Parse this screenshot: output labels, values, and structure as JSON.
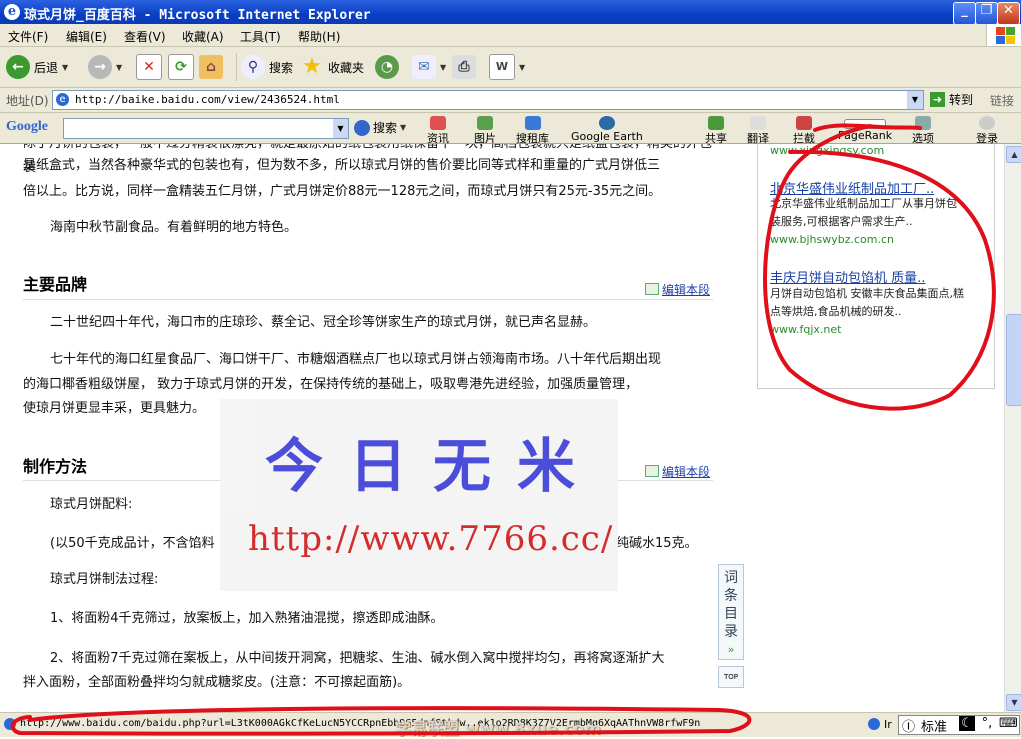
{
  "window": {
    "title": "琼式月饼_百度百科 - Microsoft Internet Explorer"
  },
  "menu": [
    "文件(F)",
    "编辑(E)",
    "查看(V)",
    "收藏(A)",
    "工具(T)",
    "帮助(H)"
  ],
  "toolbar": {
    "back": "后退",
    "search": "搜索",
    "favorites": "收藏夹"
  },
  "address": {
    "label": "地址(D)",
    "url": "http://baike.baidu.com/view/2436524.html",
    "go": "转到",
    "links": "链接"
  },
  "google": {
    "logo": "Google",
    "search": "搜索",
    "items": [
      "资讯",
      "图片",
      "搜租库",
      "Google Earth",
      "共享",
      "翻译",
      "拦截",
      "PageRank",
      "选项",
      "登录"
    ]
  },
  "article": {
    "para0a": "除了月饼的包装，一般不过分精装很漂亮，就是最原始的纸包装用纸保留下一块，高档包装就只是纸盒包装，精美的外包装",
    "para0b": "是纸盒式，当然各种豪华式的包装也有，但为数不多，所以琼式月饼的售价要比同等式样和重量的广式月饼低三",
    "para0c": "倍以上。比方说，同样一盒精装五仁月饼，广式月饼定价88元一128元之间，而琼式月饼只有25元-35元之间。",
    "para1": "海南中秋节副食品。有着鲜明的地方特色。",
    "heading1": "主要品牌",
    "edit": "编辑本段",
    "para2": "二十世纪四十年代，海口市的庄琼珍、蔡全记、冠全珍等饼家生产的琼式月饼，就已声名显赫。",
    "para3a": "七十年代的海口红星食品厂、海口饼干厂、市糖烟酒糕点厂也以琼式月饼占领海南市场。八十年代后期出现",
    "para3b": "的海口椰香粗级饼屋， 致力于琼式月饼的开发，在保持传统的基础上，吸取粤港先进经验，加强质量管理，",
    "para3c": "使琼月饼更显丰采，更具魅力。",
    "heading2": "制作方法",
    "para4": "琼式月饼配料:",
    "para5a": "(以50千克成品计，不含馅料",
    "para5b": "纯碱水15克。",
    "para6": "琼式月饼制法过程:",
    "para7": "1、将面粉4千克筛过，放案板上，加入熟猪油混搅，擦透即成油酥。",
    "para8a": "2、将面粉7千克过筛在案板上，从中间拨开洞窝，把糖浆、生油、碱水倒入窝中搅拌均匀，再将窝逐渐扩大",
    "para8b": "拌入面粉，全部面粉叠拌均匀就成糖浆皮。(注意：不可擦起面筋)。"
  },
  "ads": [
    {
      "url": "www.xingxingsy.com"
    },
    {
      "title": "北京华盛伟业纸制品加工厂..",
      "desc1": "北京华盛伟业纸制品加工厂从事月饼包",
      "desc2": "装服务,可根据客户需求生产..",
      "url": "www.bjhswybz.com.cn"
    },
    {
      "title": "丰庆月饼自动包馅机 质量..",
      "desc1": "月饼自动包馅机 安徽丰庆食品集面点,糕",
      "desc2": "点等烘焙,食品机械的研发..",
      "url": "www.fqjx.net"
    }
  ],
  "watermark": {
    "title": "今日无米",
    "url": "http://www.7766.cc/"
  },
  "toc": {
    "label": "词条目录",
    "totop": "TOP"
  },
  "status": {
    "url": "http://www.baidu.com/baidu.php?url=L3tK000AGkCfKeLucN5YCCRpnEbb9G5dnf8tkdw..ek1o2RD8K3Z7V2ErmbMq6XqAAThnVW8rfwF9n",
    "overlay": "学易联盟 www.8xue.com",
    "zone": "Ir",
    "ime": "标准"
  },
  "colors": {
    "title_bar": "#0a3fc4",
    "chrome": "#ece9d8",
    "annotation": "#e0101a",
    "link": "#1a3fa6",
    "ad_url": "#2a8a2a"
  }
}
